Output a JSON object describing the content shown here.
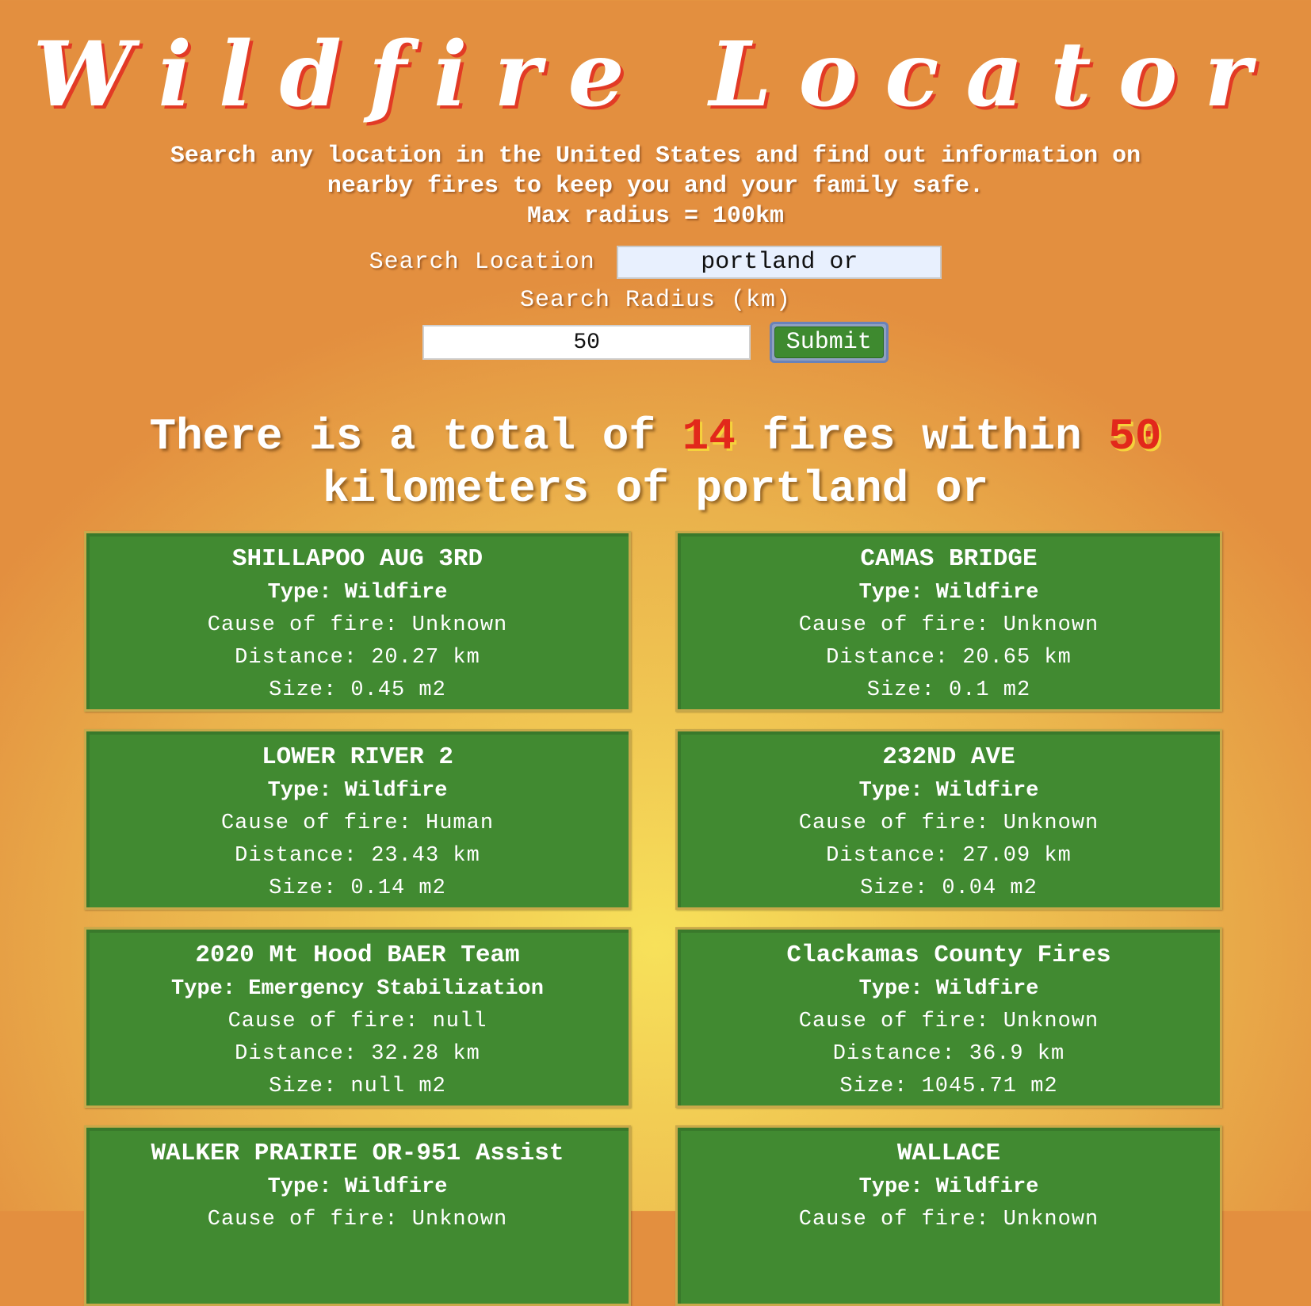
{
  "header": {
    "title": "Wildfire Locator",
    "subtitle_line1": "Search any location in the United States and find out information on",
    "subtitle_line2": "nearby fires to keep you and your family safe.",
    "subtitle_line3": "Max radius = 100km"
  },
  "form": {
    "location_label": "Search Location",
    "location_value": "portland or",
    "radius_label": "Search Radius (km)",
    "radius_value": "50",
    "submit_label": "Submit"
  },
  "summary": {
    "prefix": "There is a total of",
    "count": "14",
    "middle": "fires within",
    "radius": "50",
    "line2": "kilometers of portland or"
  },
  "fires": [
    {
      "name": "SHILLAPOO AUG 3RD",
      "type": "Type: Wildfire",
      "cause": "Cause of fire: Unknown",
      "distance": "Distance: 20.27 km",
      "size": "Size: 0.45 m2"
    },
    {
      "name": "CAMAS BRIDGE",
      "type": "Type: Wildfire",
      "cause": "Cause of fire: Unknown",
      "distance": "Distance: 20.65 km",
      "size": "Size: 0.1 m2"
    },
    {
      "name": "LOWER RIVER 2",
      "type": "Type: Wildfire",
      "cause": "Cause of fire: Human",
      "distance": "Distance: 23.43 km",
      "size": "Size: 0.14 m2"
    },
    {
      "name": "232ND AVE",
      "type": "Type: Wildfire",
      "cause": "Cause of fire: Unknown",
      "distance": "Distance: 27.09 km",
      "size": "Size: 0.04 m2"
    },
    {
      "name": "2020 Mt Hood BAER Team",
      "type": "Type: Emergency Stabilization",
      "cause": "Cause of fire: null",
      "distance": "Distance: 32.28 km",
      "size": "Size: null m2"
    },
    {
      "name": "Clackamas County Fires",
      "type": "Type: Wildfire",
      "cause": "Cause of fire: Unknown",
      "distance": "Distance: 36.9 km",
      "size": "Size: 1045.71 m2"
    },
    {
      "name": "WALKER PRAIRIE OR-951 Assist",
      "type": "Type: Wildfire",
      "cause": "Cause of fire: Unknown",
      "distance": "",
      "size": ""
    },
    {
      "name": "WALLACE",
      "type": "Type: Wildfire",
      "cause": "Cause of fire: Unknown",
      "distance": "",
      "size": ""
    }
  ]
}
